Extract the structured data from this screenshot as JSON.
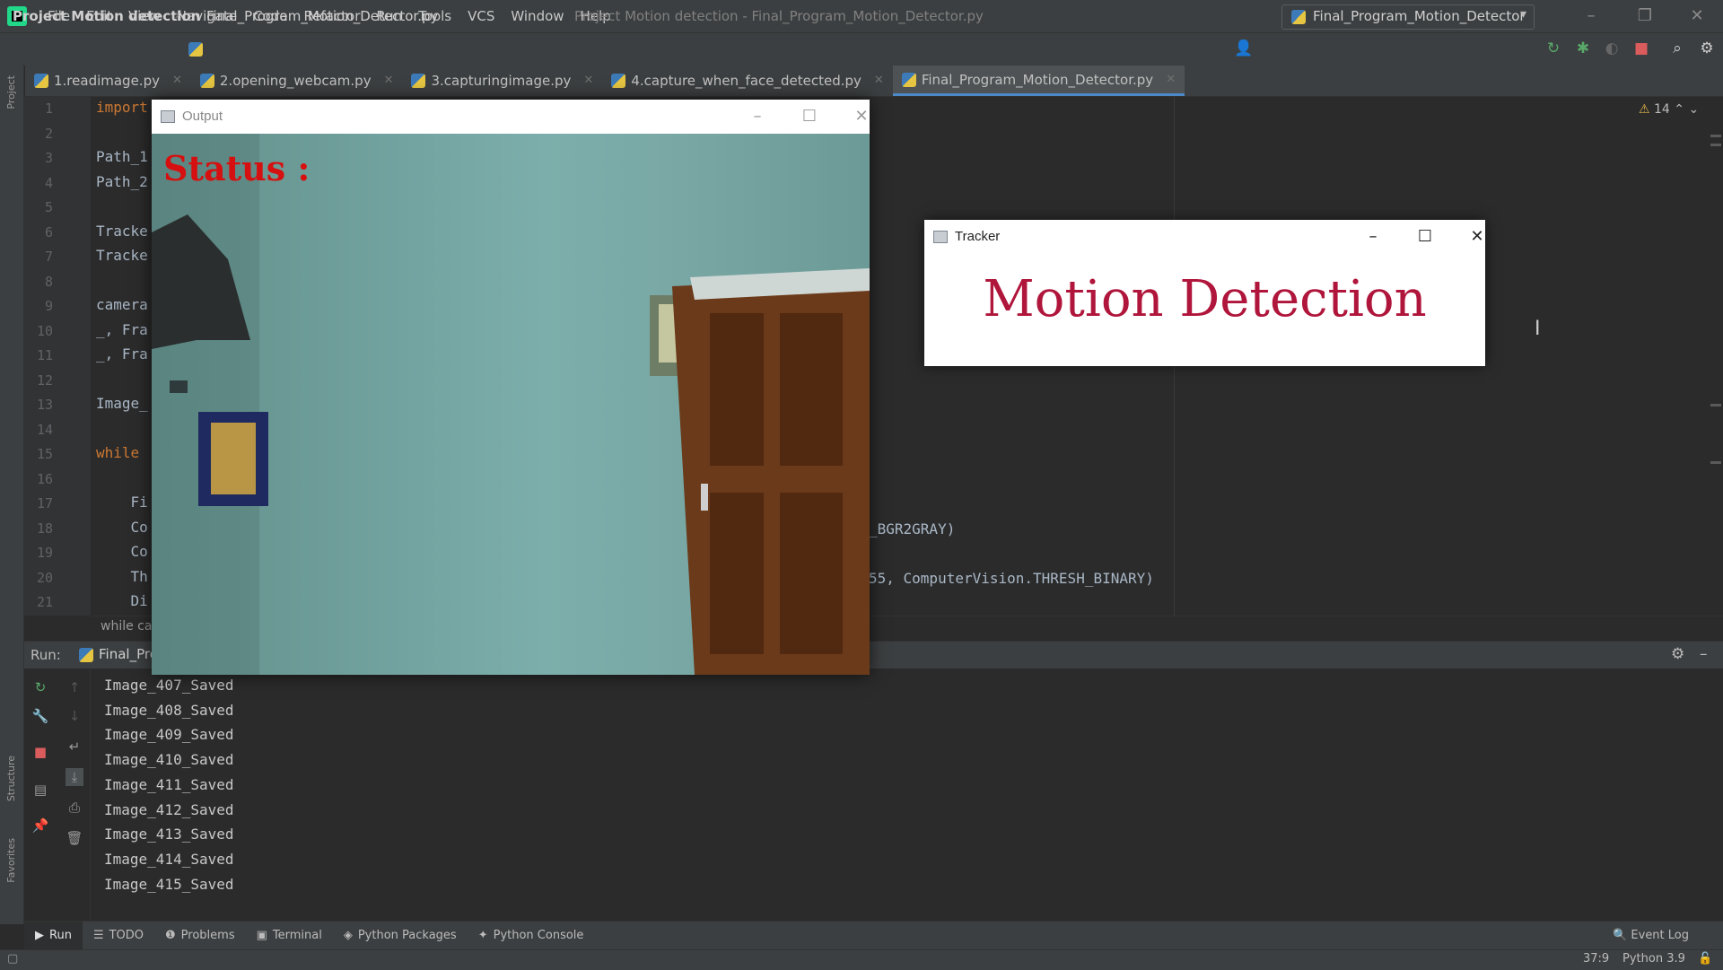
{
  "menubar": {
    "items": [
      "File",
      "Edit",
      "View",
      "Navigate",
      "Code",
      "Refactor",
      "Run",
      "Tools",
      "VCS",
      "Window",
      "Help"
    ],
    "window_title": "Project Motion detection - Final_Program_Motion_Detector.py"
  },
  "navbar": {
    "project": "Project Motion detection",
    "file": "Final_Program_Motion_Detector.py",
    "run_config": "Final_Program_Motion_Detector"
  },
  "tabs": [
    {
      "label": "1.readimage.py",
      "active": false
    },
    {
      "label": "2.opening_webcam.py",
      "active": false
    },
    {
      "label": "3.capturingimage.py",
      "active": false
    },
    {
      "label": "4.capture_when_face_detected.py",
      "active": false
    },
    {
      "label": "Final_Program_Motion_Detector.py",
      "active": true
    }
  ],
  "side_labels": {
    "project": "Project",
    "structure": "Structure",
    "favorites": "Favorites"
  },
  "editor": {
    "line_numbers": [
      "1",
      "2",
      "3",
      "4",
      "5",
      "6",
      "7",
      "8",
      "9",
      "10",
      "11",
      "12",
      "13",
      "14",
      "15",
      "16",
      "17",
      "18",
      "19",
      "20",
      "21"
    ],
    "lines": [
      {
        "kw": "import",
        "text": ""
      },
      {
        "kw": "",
        "text": ""
      },
      {
        "kw": "",
        "text": "Path_1"
      },
      {
        "kw": "",
        "text": "Path_2"
      },
      {
        "kw": "",
        "text": ""
      },
      {
        "kw": "",
        "text": "Tracke"
      },
      {
        "kw": "",
        "text": "Tracke"
      },
      {
        "kw": "",
        "text": ""
      },
      {
        "kw": "",
        "text": "camera"
      },
      {
        "kw": "",
        "text": "_, Fra"
      },
      {
        "kw": "",
        "text": "_, Fra"
      },
      {
        "kw": "",
        "text": ""
      },
      {
        "kw": "",
        "text": "Image_"
      },
      {
        "kw": "",
        "text": ""
      },
      {
        "kw": "while",
        "text": ""
      },
      {
        "kw": "",
        "text": ""
      },
      {
        "kw": "",
        "text": "    Fi"
      },
      {
        "kw": "",
        "text": "    Co"
      },
      {
        "kw": "",
        "text": "    Co"
      },
      {
        "kw": "",
        "text": "    Th"
      },
      {
        "kw": "",
        "text": "    Di"
      }
    ],
    "tail_line_18": "_BGR2GRAY)",
    "tail_line_20": "55, ComputerVision.THRESH_BINARY)",
    "warnings": "14",
    "breadcrumb": "while ca"
  },
  "run_panel": {
    "label": "Run:",
    "tab": "Final_Pro",
    "output": [
      "Image_407_Saved",
      "Image_408_Saved",
      "Image_409_Saved",
      "Image_410_Saved",
      "Image_411_Saved",
      "Image_412_Saved",
      "Image_413_Saved",
      "Image_414_Saved",
      "Image_415_Saved"
    ]
  },
  "tool_windows": [
    "Run",
    "TODO",
    "Problems",
    "Terminal",
    "Python Packages",
    "Python Console"
  ],
  "event_log": "Event Log",
  "status": {
    "position": "37:9",
    "interpreter": "Python 3.9"
  },
  "output_window": {
    "title": "Output",
    "status_text": "Status :"
  },
  "tracker_window": {
    "title": "Tracker",
    "heading": "Motion Detection"
  },
  "colors": {
    "accent": "#4a88c7",
    "status_red": "#d61010",
    "motion_red": "#b0153b",
    "keyword": "#cc7832"
  }
}
